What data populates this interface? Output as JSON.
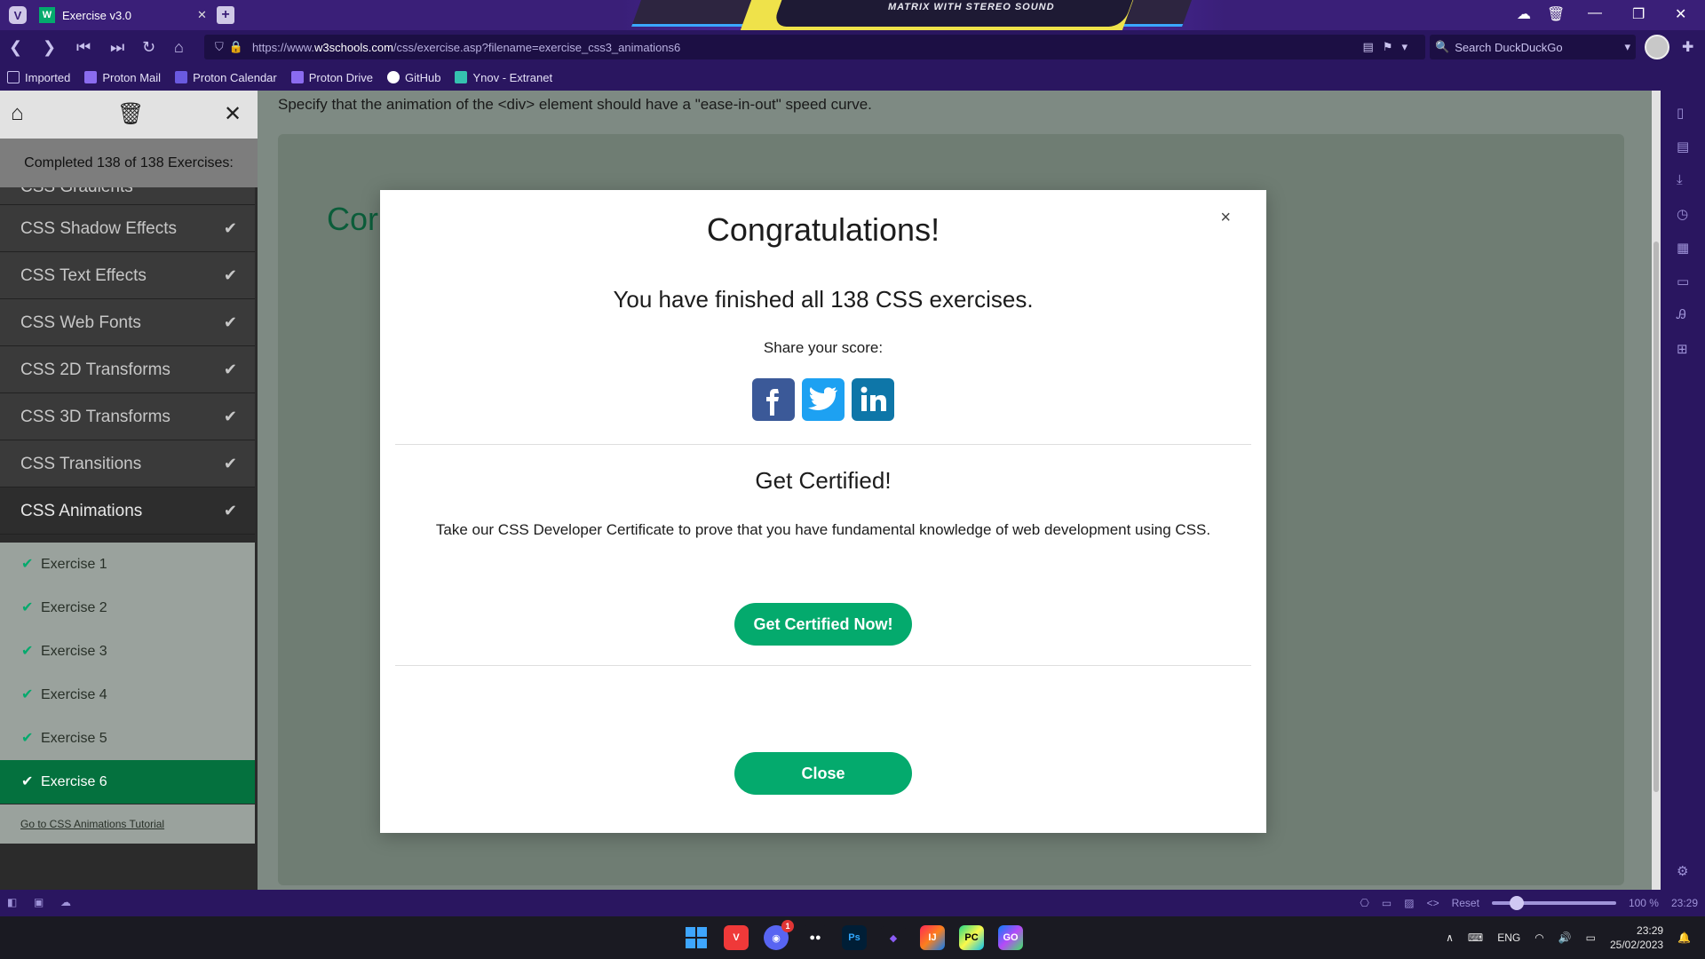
{
  "browser": {
    "tab_title": "Exercise v3.0",
    "banner_text": "MATRIX WITH STEREO SOUND",
    "url_prefix": "https://www.",
    "url_host": "w3schools.com",
    "url_path": "/css/exercise.asp?filename=exercise_css3_animations6",
    "search_placeholder": "Search DuckDuckGo"
  },
  "bookmarks": [
    {
      "label": "Imported",
      "icon": "folder-icon",
      "color": "#c9c2ee"
    },
    {
      "label": "Proton Mail",
      "icon": "proton-mail-icon",
      "color": "#8b6cf0"
    },
    {
      "label": "Proton Calendar",
      "icon": "proton-calendar-icon",
      "color": "#6a5ae0"
    },
    {
      "label": "Proton Drive",
      "icon": "proton-drive-icon",
      "color": "#8b6cf0"
    },
    {
      "label": "GitHub",
      "icon": "github-icon",
      "color": "#ffffff"
    },
    {
      "label": "Ynov - Extranet",
      "icon": "ynov-icon",
      "color": "#35c2b0"
    }
  ],
  "sidebar": {
    "completed_text": "Completed 138 of 138 Exercises:",
    "partial_item": "CSS Gradients",
    "categories": [
      {
        "label": "CSS Shadow Effects"
      },
      {
        "label": "CSS Text Effects"
      },
      {
        "label": "CSS Web Fonts"
      },
      {
        "label": "CSS 2D Transforms"
      },
      {
        "label": "CSS 3D Transforms"
      },
      {
        "label": "CSS Transitions"
      },
      {
        "label": "CSS Animations"
      }
    ],
    "exercises": [
      {
        "label": "Exercise 1"
      },
      {
        "label": "Exercise 2"
      },
      {
        "label": "Exercise 3"
      },
      {
        "label": "Exercise 4"
      },
      {
        "label": "Exercise 5"
      },
      {
        "label": "Exercise 6"
      }
    ],
    "tutorial_link": "Go to CSS Animations Tutorial"
  },
  "main": {
    "task_text": "Specify that the animation of the <div> element should have a \"ease-in-out\" speed curve.",
    "panel_title": "Cor"
  },
  "modal": {
    "close_x": "×",
    "title": "Congratulations!",
    "finished": "You have finished all 138 CSS exercises.",
    "share_label": "Share your score:",
    "cert_title": "Get Certified!",
    "cert_desc": "Take our CSS Developer Certificate to prove that you have fundamental knowledge of web development using CSS.",
    "cert_button": "Get Certified Now!",
    "close_button": "Close",
    "social": [
      {
        "name": "facebook",
        "color": "#3b5998"
      },
      {
        "name": "twitter",
        "color": "#1da1f2"
      },
      {
        "name": "linkedin",
        "color": "#0e76a8"
      }
    ]
  },
  "statusbar": {
    "reset_label": "Reset",
    "zoom": "100 %",
    "time": "23:29"
  },
  "taskbar": {
    "lang": "ENG",
    "time": "23:29",
    "date": "25/02/2023",
    "discord_badge": "1"
  },
  "colors": {
    "accent": "#04aa6d",
    "browser_chrome": "#2a1660",
    "current_exercise": "#04713e"
  }
}
